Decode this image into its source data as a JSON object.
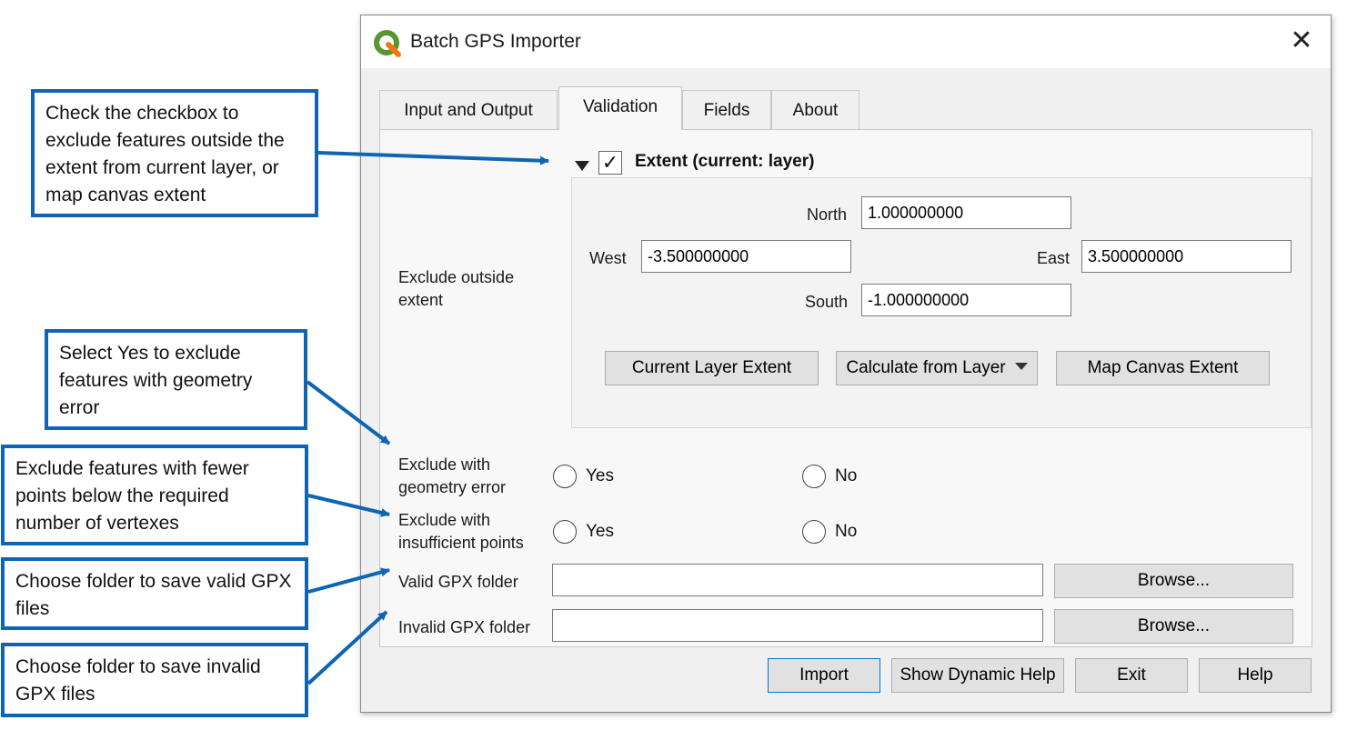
{
  "window": {
    "title": "Batch GPS Importer",
    "close_glyph": "✕",
    "app_icon": "qgis-logo"
  },
  "tabs": [
    {
      "label": "Input and Output",
      "active": false
    },
    {
      "label": "Validation",
      "active": true
    },
    {
      "label": "Fields",
      "active": false
    },
    {
      "label": "About",
      "active": false
    }
  ],
  "extent_group": {
    "title": "Extent (current: layer)",
    "checked": true,
    "section_label": "Exclude outside extent",
    "north_label": "North",
    "north_value": "1.000000000",
    "west_label": "West",
    "west_value": "-3.500000000",
    "east_label": "East",
    "east_value": "3.500000000",
    "south_label": "South",
    "south_value": "-1.000000000",
    "btn_current_layer": "Current Layer Extent",
    "btn_calculate": "Calculate from Layer",
    "btn_map_canvas": "Map Canvas Extent"
  },
  "geometry_error": {
    "label": "Exclude with geometry error",
    "yes": "Yes",
    "no": "No"
  },
  "insufficient_points": {
    "label": "Exclude with insufficient points",
    "yes": "Yes",
    "no": "No"
  },
  "valid_folder": {
    "label": "Valid GPX folder",
    "value": "",
    "browse": "Browse..."
  },
  "invalid_folder": {
    "label": "Invalid GPX folder",
    "value": "",
    "browse": "Browse..."
  },
  "footer": {
    "import": "Import",
    "help": "Show Dynamic Help",
    "exit": "Exit",
    "help2": "Help"
  },
  "callouts": {
    "extent": "Check the checkbox to exclude features outside the extent from current layer, or map canvas extent",
    "geometry": "Select Yes to exclude features with geometry error",
    "points": "Exclude features with fewer points below the required number of vertexes",
    "valid": "Choose folder to save valid GPX files",
    "invalid": "Choose folder to save invalid GPX files"
  },
  "colors": {
    "callout_border": "#0f64b3",
    "arrow": "#0f64b3",
    "qgis_green": "#589632",
    "qgis_yellow": "#ee7913"
  }
}
